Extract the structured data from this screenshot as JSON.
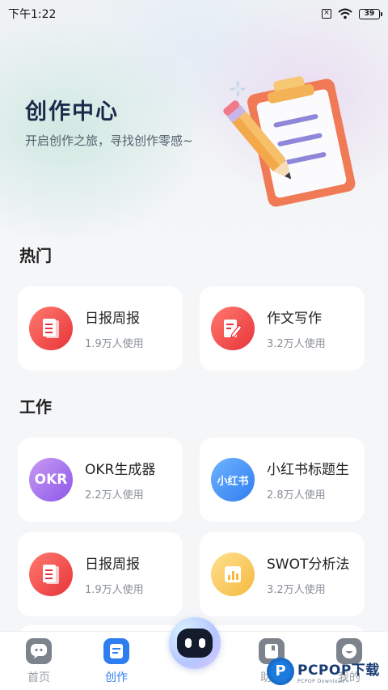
{
  "status_bar": {
    "time": "下午1:22",
    "battery": "39"
  },
  "hero": {
    "title": "创作中心",
    "subtitle": "开启创作之旅，寻找创作零感~"
  },
  "sections": [
    {
      "title": "热门",
      "cards": [
        {
          "name": "日报周报",
          "uses": "1.9万人使用",
          "icon": "report-icon",
          "color": "#e8333a"
        },
        {
          "name": "作文写作",
          "uses": "3.2万人使用",
          "icon": "essay-pen-icon",
          "color": "#e8333a"
        }
      ]
    },
    {
      "title": "工作",
      "cards": [
        {
          "name": "OKR生成器",
          "uses": "2.2万人使用",
          "icon_text": "OKR",
          "color": "#8d57e8"
        },
        {
          "name": "小红书标题生",
          "uses": "2.8万人使用",
          "icon_text": "小红书",
          "color": "#2f7ef0"
        },
        {
          "name": "日报周报",
          "uses": "1.9万人使用",
          "icon": "report-icon",
          "color": "#e8333a"
        },
        {
          "name": "SWOT分析法",
          "uses": "3.2万人使用",
          "icon": "bar-chart-icon",
          "color": "#f5b940"
        }
      ]
    }
  ],
  "tabbar": {
    "items": [
      {
        "label": "首页",
        "icon": "chat-bubble-icon"
      },
      {
        "label": "创作",
        "icon": "document-icon",
        "active": true
      },
      {
        "label": "助手",
        "icon": "bookmark-icon"
      },
      {
        "label": "我的",
        "icon": "smile-face-icon"
      }
    ],
    "center": {
      "icon": "robot-icon"
    }
  },
  "watermark": {
    "logo_letter": "P",
    "main": "PCPOP下载",
    "sub": "PCPOP Download"
  },
  "colors": {
    "accent": "#2f7ef0",
    "title": "#1b2a4a"
  }
}
